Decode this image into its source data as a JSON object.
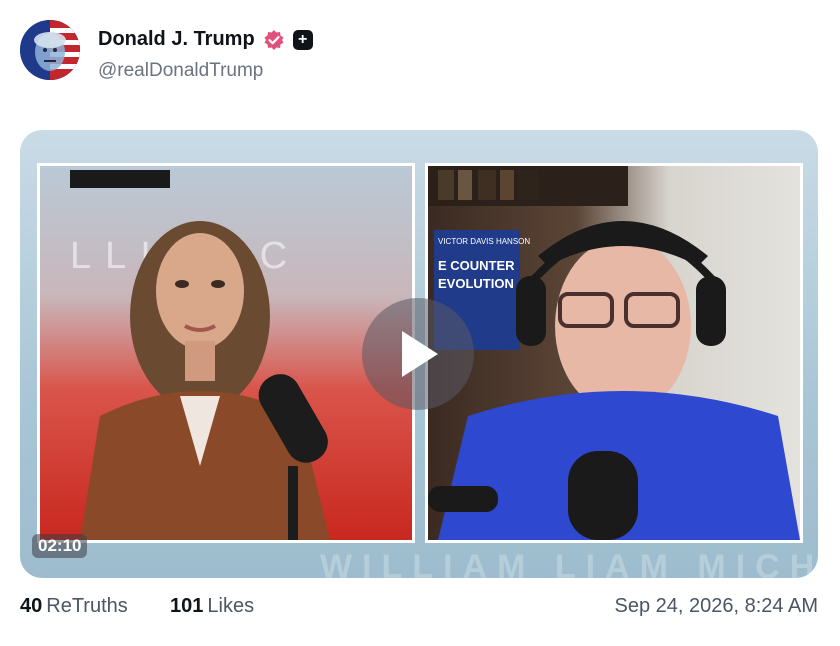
{
  "post": {
    "author_name": "Donald J. Trump",
    "author_handle": "@realDonaldTrump",
    "verified_icon": "verified-badge-icon",
    "plus_badge": "+",
    "video": {
      "duration": "02:10",
      "left_watermark_text": "LLI   MIC",
      "bottom_watermark_text": "WILLIAM LIAM MICHAE",
      "book_title_line1": "VICTOR DAVIS HANSON",
      "book_title_line2": "E COUNTER",
      "book_title_line3": "EVOLUTION"
    },
    "stats": {
      "retruths_count": "40",
      "retruths_label": "ReTruths",
      "likes_count": "101",
      "likes_label": "Likes"
    },
    "timestamp": "Sep 24, 2026, 8:24 AM"
  },
  "colors": {
    "verified": "#e0527d",
    "text_primary": "#0f1419",
    "text_secondary": "#6b7280"
  }
}
